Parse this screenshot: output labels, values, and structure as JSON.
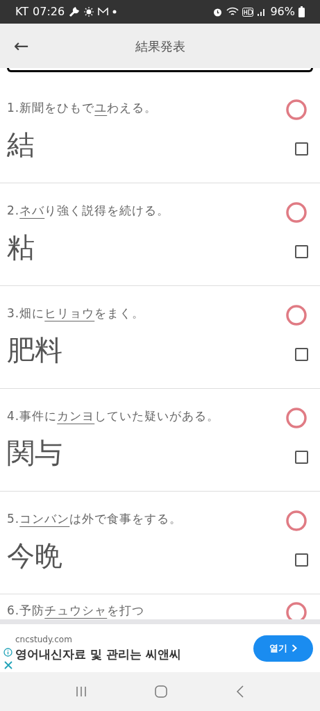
{
  "status_bar": {
    "carrier": "KT",
    "time": "07:26",
    "battery": "96%"
  },
  "header": {
    "back": "←",
    "title": "結果発表"
  },
  "items": [
    {
      "number": "1.",
      "before": "新聞をひもで",
      "underlined": "ユ",
      "after": "わえる。",
      "answer": "結",
      "correct": true,
      "checked": false
    },
    {
      "number": "2.",
      "underlined": "ネバ",
      "after": "り強く説得を続ける。",
      "answer": "粘",
      "correct": true,
      "checked": false
    },
    {
      "number": "3.",
      "before": "畑に",
      "underlined": "ヒリョウ",
      "after": "をまく。",
      "answer": "肥料",
      "correct": true,
      "checked": false
    },
    {
      "number": "4.",
      "before": "事件に",
      "underlined": "カンヨ",
      "after": "していた疑いがある。",
      "answer": "関与",
      "correct": true,
      "checked": false
    },
    {
      "number": "5.",
      "underlined": "コンバン",
      "after": "は外で食事をする。",
      "answer": "今晩",
      "correct": true,
      "checked": false
    },
    {
      "number": "6.",
      "before": "予防",
      "underlined": "チュウシャ",
      "after": "を打つ",
      "correct": true
    }
  ],
  "ad": {
    "domain": "cncstudy.com",
    "headline": "영어내신자료 및 관리는 씨앤씨",
    "button": "열기"
  }
}
